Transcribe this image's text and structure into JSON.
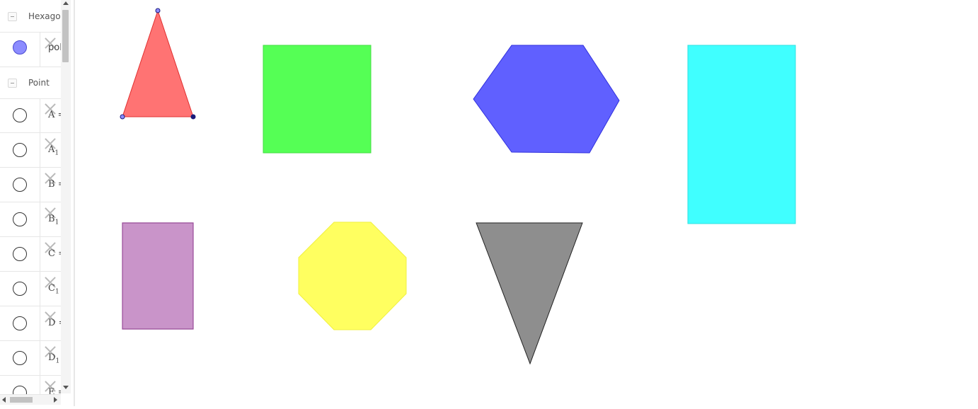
{
  "algebra_view": {
    "groups": [
      {
        "label": "Hexagon",
        "items": [
          {
            "text": "pol",
            "visible": true,
            "color": "#8c8cff"
          }
        ]
      },
      {
        "label": "Point",
        "items": [
          {
            "name": "A",
            "suffix": " ="
          },
          {
            "name": "A",
            "sub": "1"
          },
          {
            "name": "B",
            "suffix": " ="
          },
          {
            "name": "B",
            "sub": "1"
          },
          {
            "name": "C",
            "suffix": " ="
          },
          {
            "name": "C",
            "sub": "1"
          },
          {
            "name": "D",
            "suffix": " ="
          },
          {
            "name": "D",
            "sub": "1"
          },
          {
            "name": "E",
            "suffix": " ="
          }
        ]
      }
    ]
  },
  "graphics_view": {
    "shapes": [
      {
        "name": "triangle",
        "fill": "#ff7373",
        "stroke": "#e03030"
      },
      {
        "name": "square",
        "fill": "#55ff55",
        "stroke": "#44dd44"
      },
      {
        "name": "hexagon",
        "fill": "#6060ff",
        "stroke": "#3030dd"
      },
      {
        "name": "rectangle",
        "fill": "#40ffff",
        "stroke": "#30e0e0"
      },
      {
        "name": "purple-rectangle",
        "fill": "#c994c9",
        "stroke": "#994c99"
      },
      {
        "name": "octagon",
        "fill": "#ffff60",
        "stroke": "#f0f040"
      },
      {
        "name": "inverted-triangle",
        "fill": "#8e8e8e",
        "stroke": "#222222"
      }
    ],
    "point_color": "#8c8cff",
    "point_dark_color": "#1a1a7a"
  }
}
